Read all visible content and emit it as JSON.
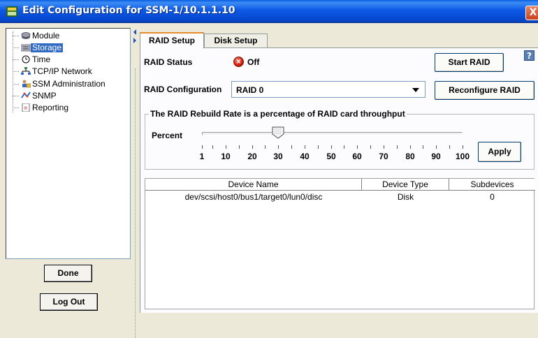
{
  "window": {
    "title": "Edit Configuration for SSM-1/10.1.1.10",
    "close_glyph": "X",
    "title_icon": "app-icon"
  },
  "sidebar": {
    "items": [
      {
        "label": "Module",
        "icon": "module-icon"
      },
      {
        "label": "Storage",
        "icon": "storage-icon",
        "selected": true
      },
      {
        "label": "Time",
        "icon": "clock-icon"
      },
      {
        "label": "TCP/IP Network",
        "icon": "network-icon"
      },
      {
        "label": "SSM Administration",
        "icon": "admin-icon"
      },
      {
        "label": "SNMP",
        "icon": "snmp-icon"
      },
      {
        "label": "Reporting",
        "icon": "report-icon"
      }
    ],
    "done_label": "Done",
    "logout_label": "Log Out"
  },
  "tabs": [
    {
      "label": "RAID Setup",
      "active": true
    },
    {
      "label": "Disk Setup",
      "active": false
    }
  ],
  "raid": {
    "status_label": "RAID Status",
    "status_value": "Off",
    "status_icon": "error-icon",
    "start_label": "Start RAID",
    "config_label": "RAID Configuration",
    "config_value": "RAID 0",
    "reconfigure_label": "Reconfigure RAID",
    "help_glyph": "?"
  },
  "rebuild": {
    "group_title": "The RAID Rebuild Rate is a percentage of RAID card throughput",
    "percent_label": "Percent",
    "value": 30,
    "min": 1,
    "max": 100,
    "tick_labels": [
      "1",
      "10",
      "20",
      "30",
      "40",
      "50",
      "60",
      "70",
      "80",
      "90",
      "100"
    ],
    "apply_label": "Apply"
  },
  "devices": {
    "columns": [
      "Device Name",
      "Device Type",
      "Subdevices"
    ],
    "rows": [
      {
        "name": "dev/scsi/host0/bus1/target0/lun0/disc",
        "type": "Disk",
        "subdevices": "0"
      }
    ]
  },
  "colors": {
    "titlebar": "#0548d0",
    "selection": "#316ac5",
    "tab_highlight": "#e68b2c",
    "status_off": "#d01a0a"
  }
}
